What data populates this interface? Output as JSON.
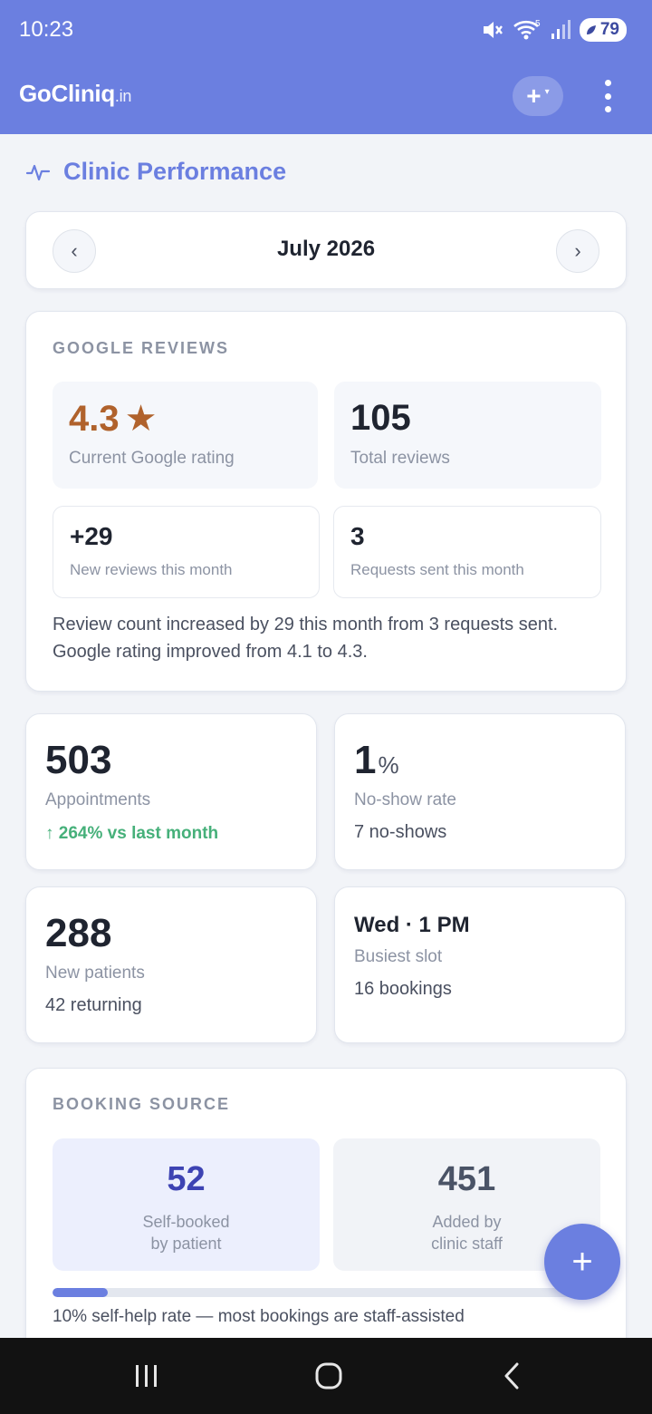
{
  "status_bar": {
    "time": "10:23",
    "network_label": "5",
    "battery": "79"
  },
  "header": {
    "brand_name": "GoCliniq",
    "brand_tld": ".in",
    "add_label": "+",
    "caret": "▾",
    "accent_color": "#6b7fe0"
  },
  "page": {
    "title": "Clinic Performance",
    "title_icon": "activity-pulse-icon"
  },
  "month_nav": {
    "prev": "‹",
    "label": "July 2026",
    "next": "›"
  },
  "google_reviews": {
    "section_label": "GOOGLE REVIEWS",
    "rating_value": "4.3",
    "rating_star": "★",
    "rating_label": "Current Google rating",
    "total_value": "105",
    "total_label": "Total reviews",
    "new_value": "+29",
    "new_label": "New reviews this month",
    "requests_value": "3",
    "requests_label": "Requests sent this month",
    "summary": "Review count increased by 29 this month from 3 requests sent. Google rating improved from 4.1 to 4.3."
  },
  "stats": {
    "appointments": {
      "value": "503",
      "label": "Appointments",
      "extra": "↑ 264% vs last month"
    },
    "no_show": {
      "value": "1",
      "unit": "%",
      "label": "No-show rate",
      "extra": "7 no-shows"
    },
    "new_patients": {
      "value": "288",
      "label": "New patients",
      "extra": "42 returning"
    },
    "busiest": {
      "value": "Wed · 1 PM",
      "label": "Busiest slot",
      "extra": "16 bookings"
    }
  },
  "booking_source": {
    "section_label": "BOOKING SOURCE",
    "self_value": "52",
    "self_line1": "Self-booked",
    "self_line2": "by patient",
    "staff_value": "451",
    "staff_line1": "Added by",
    "staff_line2": "clinic staff",
    "self_help_fraction": 0.1,
    "note": "10% self-help rate — most bookings are staff-assisted"
  },
  "fab": {
    "label": "+"
  }
}
